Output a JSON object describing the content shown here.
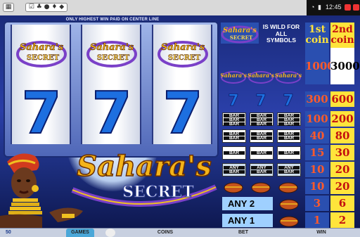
{
  "statusbar": {
    "time": "12:45",
    "icons": [
      "checkbox-icon",
      "chat-icon",
      "card-suit-icon",
      "dot-icon",
      "minimize-icon",
      "close-icon"
    ]
  },
  "game": {
    "header_note": "ONLY HIGHEST WIN PAID ON CENTER LINE",
    "title_line1": "Sahara's",
    "title_line2": "SECRET",
    "reels": [
      {
        "top": "sahara-secret-logo",
        "center": "7"
      },
      {
        "top": "sahara-secret-logo",
        "center": "7"
      },
      {
        "top": "sahara-secret-logo",
        "center": "7"
      }
    ]
  },
  "paytable": {
    "wild_text": "IS WILD FOR ALL SYMBOLS",
    "col1_header": "1st coin",
    "col2_header": "2nd coin",
    "rows": [
      {
        "symbols": "3x logo",
        "c1": "1000",
        "c2": "3000"
      },
      {
        "symbols": "3x seven",
        "c1": "300",
        "c2": "600"
      },
      {
        "symbols": "3x triple bar",
        "c1": "100",
        "c2": "200"
      },
      {
        "symbols": "3x double bar",
        "c1": "40",
        "c2": "80"
      },
      {
        "symbols": "3x single bar",
        "c1": "15",
        "c2": "30"
      },
      {
        "symbols": "3x any bar",
        "c1": "10",
        "c2": "20"
      },
      {
        "symbols": "3x pot",
        "c1": "10",
        "c2": "20"
      },
      {
        "symbols": "any 2 pots",
        "label": "ANY 2",
        "c1": "3",
        "c2": "6"
      },
      {
        "symbols": "any 1 pot",
        "label": "ANY 1",
        "c1": "1",
        "c2": "2"
      }
    ],
    "bar_label": "BAR",
    "any_label": "ANY"
  },
  "bottombar": {
    "games": "GAMES",
    "coins": "COINS",
    "bet": "BET",
    "win": "WIN",
    "balance_prefix": "50"
  },
  "colors": {
    "sky": "#2a3fa8",
    "col1": "#2a4fb0",
    "col2": "#ffe43b",
    "seven": "#1d6fe0"
  }
}
